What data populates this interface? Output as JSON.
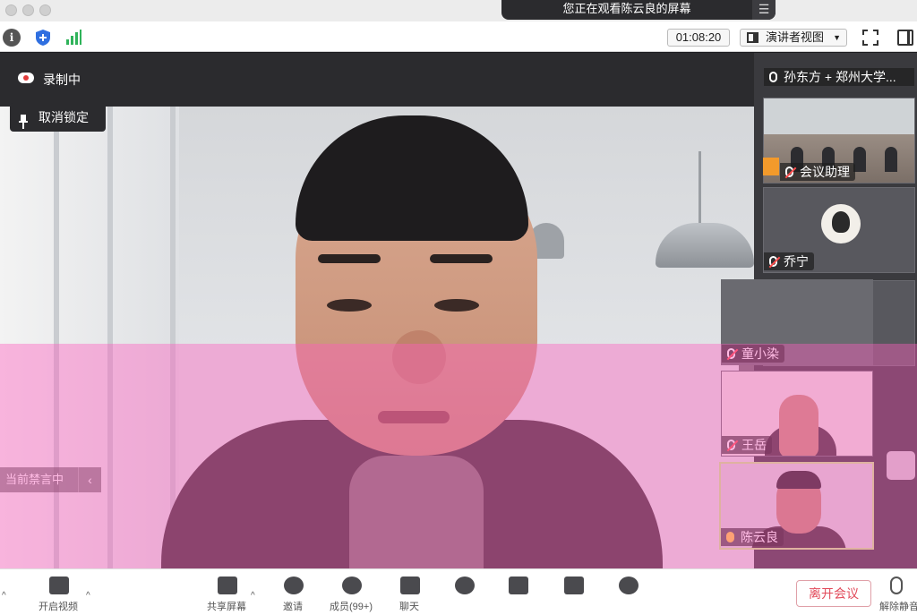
{
  "window": {
    "share_banner": "您正在观看陈云良的屏幕",
    "menu_glyph": "☰"
  },
  "toolbar": {
    "info_glyph": "i",
    "timer": "01:08:20",
    "view_mode": "演讲者视图",
    "view_caret": "▼"
  },
  "main": {
    "recording_label": "录制中",
    "unlock_label": "取消锁定",
    "mute_all_label": "当前禁言中",
    "mute_all_chevron": "‹",
    "side_arrow": "›"
  },
  "participants": {
    "top_partial_name": "孙东方 + 郑州大学...",
    "items": [
      {
        "name": "会议助理",
        "muted": true
      },
      {
        "name": "乔宁",
        "muted": true
      },
      {
        "name": "童小染",
        "muted": true
      },
      {
        "name": "王岳",
        "muted": true
      },
      {
        "name": "陈云良",
        "muted": false
      }
    ]
  },
  "bottombar": {
    "video_label": "开启视频",
    "share_label": "共享屏幕",
    "invite_label": "邀请",
    "members_label": "成员(99+)",
    "chat_label": "聊天",
    "leave_label": "离开会议",
    "unmute_label": "解除静音",
    "caret": "^"
  },
  "colors": {
    "accent_red": "#e24b5b",
    "recording_dot": "#e23b3b",
    "active_mic": "#ffd23f",
    "muted_mic": "#ff4d4d",
    "self_border": "#c8f08a"
  }
}
